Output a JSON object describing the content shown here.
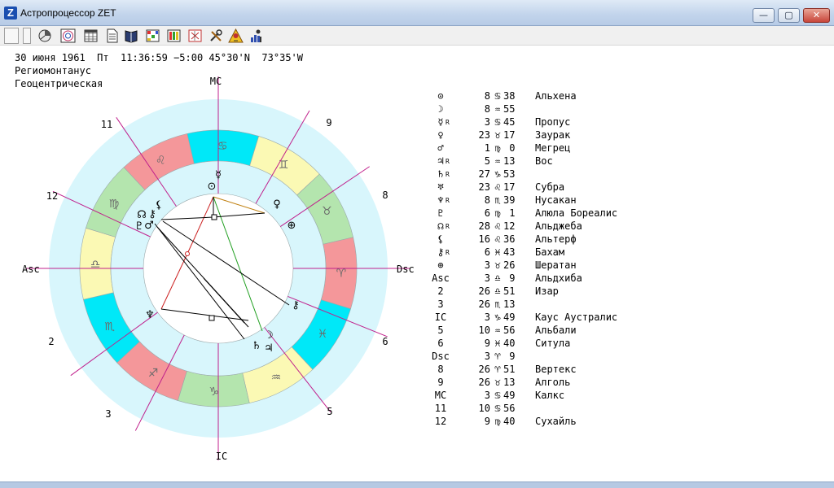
{
  "window": {
    "title": "Астропроцессор ZET",
    "app_icon_letter": "Z",
    "minimize_label": "—",
    "maximize_label": "▢",
    "close_label": "✕"
  },
  "toolbar": {
    "icons": [
      "new-chart-icon",
      "horoscope-icon",
      "wheel-icon",
      "calendar-icon",
      "document-icon",
      "interpretation-icon",
      "table-icon",
      "transits-icon",
      "settings-icon",
      "alert-icon",
      "statistics-icon"
    ]
  },
  "chart_info": {
    "datetime": "30 июня 1961  Пт  11:36:59 −5:00 45°30'N  73°35'W",
    "house_system": "Региомонтанус",
    "view": "Геоцентрическая"
  },
  "wheel": {
    "angles": {
      "mc": "MC",
      "ic": "IC",
      "asc": "Asc",
      "dsc": "Dsc"
    },
    "house_numbers": [
      "2",
      "3",
      "5",
      "6",
      "8",
      "9",
      "11",
      "12"
    ],
    "signs": [
      "♋",
      "♊",
      "♉",
      "♈",
      "♓",
      "♒",
      "♑",
      "♐",
      "♏",
      "♎",
      "♍",
      "♌"
    ],
    "sign_colors": {
      "fire": "#f4979a",
      "earth": "#b4e5ae",
      "air": "#fbf9b4",
      "water": "#00e8f8"
    },
    "ring_color": "#d8f6fc",
    "planet_glyphs": {
      "sun": "⊙",
      "moon": "☽",
      "mercury": "☿",
      "venus": "♀",
      "mars": "♂",
      "jupiter": "♃",
      "saturn": "♄",
      "neptune": "♆",
      "pluto": "♇",
      "node": "☊",
      "lilith": "⚸",
      "lilith2": "⚸",
      "chiron": "⚷",
      "fortune": "⊕"
    }
  },
  "planets": [
    {
      "symbol": "⊙",
      "retro": "",
      "degree": "8",
      "sign": "♋",
      "minutes": "38",
      "star": "Альхена"
    },
    {
      "symbol": "☽",
      "retro": "",
      "degree": "8",
      "sign": "♒",
      "minutes": "55",
      "star": ""
    },
    {
      "symbol": "☿",
      "retro": "R",
      "degree": "3",
      "sign": "♋",
      "minutes": "45",
      "star": "Пропус"
    },
    {
      "symbol": "♀",
      "retro": "",
      "degree": "23",
      "sign": "♉",
      "minutes": "17",
      "star": "Заурак"
    },
    {
      "symbol": "♂",
      "retro": "",
      "degree": "1",
      "sign": "♍",
      "minutes": " 0",
      "star": "Мегрец"
    },
    {
      "symbol": "♃",
      "retro": "R",
      "degree": "5",
      "sign": "♒",
      "minutes": "13",
      "star": "Вос"
    },
    {
      "symbol": "♄",
      "retro": "R",
      "degree": "27",
      "sign": "♑",
      "minutes": "53",
      "star": ""
    },
    {
      "symbol": "♅",
      "retro": "",
      "degree": "23",
      "sign": "♌",
      "minutes": "17",
      "star": "Субра"
    },
    {
      "symbol": "♆",
      "retro": "R",
      "degree": "8",
      "sign": "♏",
      "minutes": "39",
      "star": "Нусакан"
    },
    {
      "symbol": "♇",
      "retro": "",
      "degree": "6",
      "sign": "♍",
      "minutes": " 1",
      "star": "Алюла Бореалис"
    },
    {
      "symbol": "☊",
      "retro": "R",
      "degree": "28",
      "sign": "♌",
      "minutes": "12",
      "star": "Альджеба"
    },
    {
      "symbol": "⚸",
      "retro": "",
      "degree": "16",
      "sign": "♌",
      "minutes": "36",
      "star": "Альтерф"
    },
    {
      "symbol": "⚷",
      "retro": "R",
      "degree": "6",
      "sign": "♓",
      "minutes": "43",
      "star": "Бахам"
    },
    {
      "symbol": "⊕",
      "retro": "",
      "degree": "3",
      "sign": "♉",
      "minutes": "26",
      "star": "Шератан"
    },
    {
      "symbol": "Asc",
      "retro": "",
      "degree": "3",
      "sign": "♎",
      "minutes": " 9",
      "star": "Альдхиба"
    },
    {
      "symbol": "2",
      "retro": "",
      "degree": "26",
      "sign": "♎",
      "minutes": "51",
      "star": "Изар"
    },
    {
      "symbol": "3",
      "retro": "",
      "degree": "26",
      "sign": "♏",
      "minutes": "13",
      "star": ""
    },
    {
      "symbol": "IC",
      "retro": "",
      "degree": "3",
      "sign": "♑",
      "minutes": "49",
      "star": "Каус Аустралис"
    },
    {
      "symbol": "5",
      "retro": "",
      "degree": "10",
      "sign": "♒",
      "minutes": "56",
      "star": "Альбали"
    },
    {
      "symbol": "6",
      "retro": "",
      "degree": "9",
      "sign": "♓",
      "minutes": "40",
      "star": "Ситула"
    },
    {
      "symbol": "Dsc",
      "retro": "",
      "degree": "3",
      "sign": "♈",
      "minutes": " 9",
      "star": ""
    },
    {
      "symbol": "8",
      "retro": "",
      "degree": "26",
      "sign": "♈",
      "minutes": "51",
      "star": "Вертекс"
    },
    {
      "symbol": "9",
      "retro": "",
      "degree": "26",
      "sign": "♉",
      "minutes": "13",
      "star": "Алголь"
    },
    {
      "symbol": "MC",
      "retro": "",
      "degree": "3",
      "sign": "♋",
      "minutes": "49",
      "star": "Калкс"
    },
    {
      "symbol": "11",
      "retro": "",
      "degree": "10",
      "sign": "♋",
      "minutes": "56",
      "star": ""
    },
    {
      "symbol": "12",
      "retro": "",
      "degree": "9",
      "sign": "♍",
      "minutes": "40",
      "star": "Сухайль"
    }
  ]
}
